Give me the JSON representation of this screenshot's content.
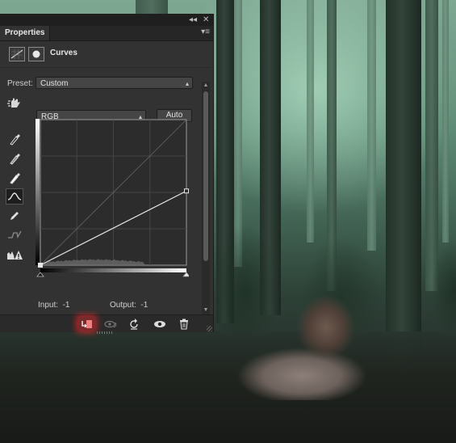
{
  "panel": {
    "tab_label": "Properties",
    "adjustment_title": "Curves",
    "preset_label": "Preset:",
    "preset_value": "Custom",
    "channel_value": "RGB",
    "auto_label": "Auto",
    "input_label": "Input:",
    "input_value": "-1",
    "output_label": "Output:",
    "output_value": "-1"
  },
  "curve": {
    "points": [
      [
        0,
        0
      ],
      [
        255,
        130
      ]
    ]
  },
  "icons": {
    "topbar": [
      "collapse-icon",
      "close-icon"
    ],
    "header": [
      "curves-adjustment-icon",
      "layer-mask-icon"
    ],
    "tools": [
      "on-image-adjust-icon",
      "black-point-eyedropper-icon",
      "gray-point-eyedropper-icon",
      "white-point-eyedropper-icon",
      "curve-points-icon",
      "pencil-draw-icon",
      "smooth-curve-icon",
      "clipping-warning-icon"
    ],
    "bottom": [
      "clip-to-layer-icon",
      "view-previous-icon",
      "reset-icon",
      "visibility-eye-icon",
      "trash-icon"
    ]
  },
  "colors": {
    "panel_bg": "#323232",
    "clip_glow": "#e62828"
  }
}
